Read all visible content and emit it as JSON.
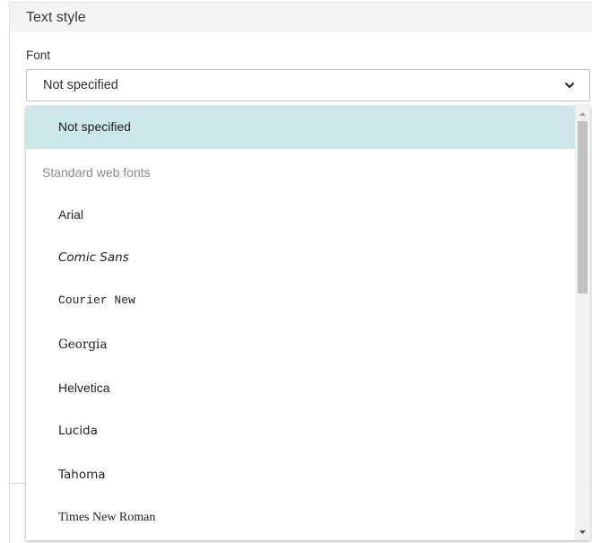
{
  "panel": {
    "title": "Text style"
  },
  "font_field": {
    "label": "Font",
    "selected_value": "Not specified"
  },
  "dropdown": {
    "top_option": "Not specified",
    "group_label": "Standard web fonts",
    "options": [
      {
        "label": "Arial",
        "font": "sans"
      },
      {
        "label": "Comic Sans",
        "font": "comic"
      },
      {
        "label": "Courier New",
        "font": "mono"
      },
      {
        "label": "Georgia",
        "font": "serif"
      },
      {
        "label": "Helvetica",
        "font": "sans"
      },
      {
        "label": "Lucida",
        "font": "sans"
      },
      {
        "label": "Tahoma",
        "font": "sans"
      },
      {
        "label": "Times New Roman",
        "font": "serif"
      }
    ]
  },
  "colors": {
    "selected_bg": "#cbe6e6",
    "header_bg": "#f4f4f4",
    "group_label": "#8a8a8a"
  },
  "icons": {
    "select_chevron": "chevron-down-icon",
    "scroll_up": "triangle-up-icon",
    "scroll_down": "triangle-down-icon"
  }
}
